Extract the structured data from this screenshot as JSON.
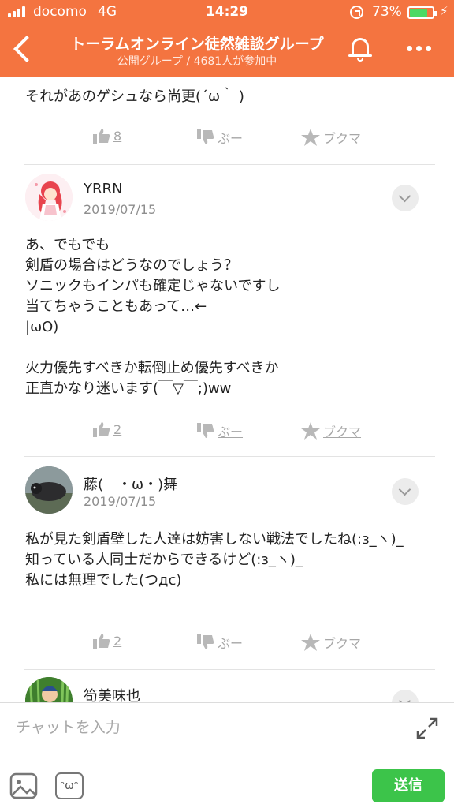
{
  "status_bar": {
    "carrier": "docomo",
    "network": "4G",
    "time": "14:29",
    "battery_text": "73%",
    "battery_level": 0.73
  },
  "header": {
    "title": "トーラムオンライン徒然雑談グループ",
    "subtitle": "公開グループ / 4681人が参加中",
    "accent_color": "#f47440"
  },
  "feed": {
    "first_post": {
      "text": "それがあのゲシュなら尚更(´ω｀ )",
      "likes": "8",
      "boo_label": "ぶー",
      "bookmark_label": "ブクマ"
    },
    "posts": [
      {
        "user": "YRRN",
        "date": "2019/07/15",
        "text": "あ、でもでも\n剣盾の場合はどうなのでしょう？\nソニックもインパも確定じゃないですし\n当てちゃうこともあって…←\n|ωO)\n\n火力優先すべきか転倒止め優先すべきか\n正直かなり迷います(￣▽￣;)ww",
        "likes": "2",
        "boo_label": "ぶー",
        "bookmark_label": "ブクマ"
      },
      {
        "user": "藤(　・ω・)舞",
        "date": "2019/07/15",
        "text": "私が見た剣盾壁した人達は妨害しない戦法でしたね(:з_ヽ)_\n知っている人同士だからできるけど(:з_ヽ)_\n私には無理でした(つдc)",
        "likes": "2",
        "boo_label": "ぶー",
        "bookmark_label": "ブクマ"
      },
      {
        "user": "筍美味也"
      }
    ]
  },
  "composer": {
    "placeholder": "チャットを入力",
    "send_label": "送信",
    "send_color": "#3cc44a"
  },
  "icons": {
    "back": "chevron-left-icon",
    "bell": "bell-icon",
    "more": "more-dots-icon",
    "like": "thumbs-up-icon",
    "boo": "thumbs-down-icon",
    "bookmark": "star-icon",
    "expand": "expand-icon",
    "image": "image-icon",
    "emoji": "emoji-icon"
  }
}
